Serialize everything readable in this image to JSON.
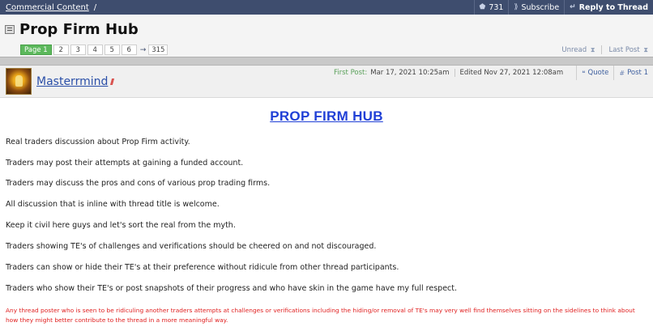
{
  "breadcrumb": {
    "section": "Commercial Content",
    "separator": "/"
  },
  "topbar": {
    "subscribers_count": "731",
    "subscribe_label": "Subscribe",
    "reply_label": "Reply to Thread"
  },
  "thread": {
    "title": "Prop Firm Hub"
  },
  "pagination": {
    "pages": [
      "Page 1",
      "2",
      "3",
      "4",
      "5",
      "6"
    ],
    "arrow": "→",
    "last_page": "315"
  },
  "nav_links": {
    "unread": "Unread",
    "last_post": "Last Post"
  },
  "post": {
    "username": "Masterrmind",
    "first_post_label": "First Post:",
    "first_post_date": "Mar 17, 2021 10:25am",
    "edited_text": "Edited Nov 27, 2021 12:08am",
    "quote_label": "Quote",
    "post_number_label": "Post 1",
    "heading": "PROP FIRM HUB",
    "paragraphs": [
      "Real traders discussion about Prop Firm activity.",
      "Traders may post their attempts at gaining a funded account.",
      "Traders may discuss the pros and cons of various prop trading firms.",
      "All discussion that is inline with thread title is welcome.",
      "Keep it civil here guys and let's sort the real from the myth.",
      "Traders showing TE's of challenges and verifications should be cheered on and not discouraged.",
      "Traders can show or hide their TE's at their preference without ridicule from other thread participants.",
      "Traders who show their TE's or post snapshots of their progress and who have skin in the game have my full respect."
    ],
    "warning": "Any thread poster who is seen to be ridiculing another traders attempts at challenges or verifications including the hiding/or removal of TE's may very well find themselves sitting on the sidelines to think about how they might better contribute to the thread in a more meaningful way."
  },
  "icons": {
    "tag": "tag-icon",
    "subscribe": "subscribe-icon",
    "reply": "reply-icon",
    "thread": "thread-icon",
    "hourglass": "hourglass-icon",
    "quote": "quote-icon",
    "post_link": "hash-icon"
  },
  "colors": {
    "topbar_bg": "#3e4d6e",
    "current_page": "#5cb85c",
    "heading_link": "#1f3fd6",
    "username": "#2a4fa8",
    "warning_text": "#e02020",
    "first_post_label": "#5aa05a"
  }
}
